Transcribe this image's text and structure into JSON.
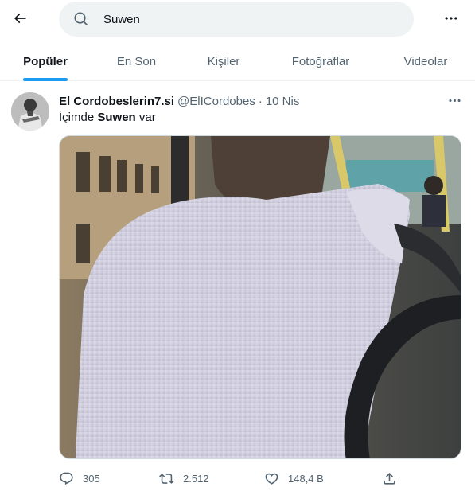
{
  "search": {
    "query": "Suwen"
  },
  "tabs": [
    {
      "label": "Popüler",
      "active": true
    },
    {
      "label": "En Son",
      "active": false
    },
    {
      "label": "Kişiler",
      "active": false
    },
    {
      "label": "Fotoğraflar",
      "active": false
    },
    {
      "label": "Videolar",
      "active": false
    }
  ],
  "tweet": {
    "display_name": "El Cordobeslerin7.si",
    "handle": "@ElICordobes",
    "separator": "·",
    "time": "10 Nis",
    "text_before": "İçimde ",
    "text_bold": "Suwen",
    "text_after": " var",
    "actions": {
      "replies": "305",
      "retweets": "2.512",
      "likes": "148,4 B"
    }
  },
  "icons": {
    "back": "arrow-left-icon",
    "search": "search-icon",
    "more": "ellipsis-icon",
    "reply": "reply-icon",
    "retweet": "retweet-icon",
    "like": "heart-icon",
    "share": "share-icon"
  },
  "colors": {
    "accent": "#1d9bf0",
    "text_primary": "#0f1419",
    "text_secondary": "#536471",
    "search_bg": "#eff3f4",
    "border": "#eff3f4"
  }
}
